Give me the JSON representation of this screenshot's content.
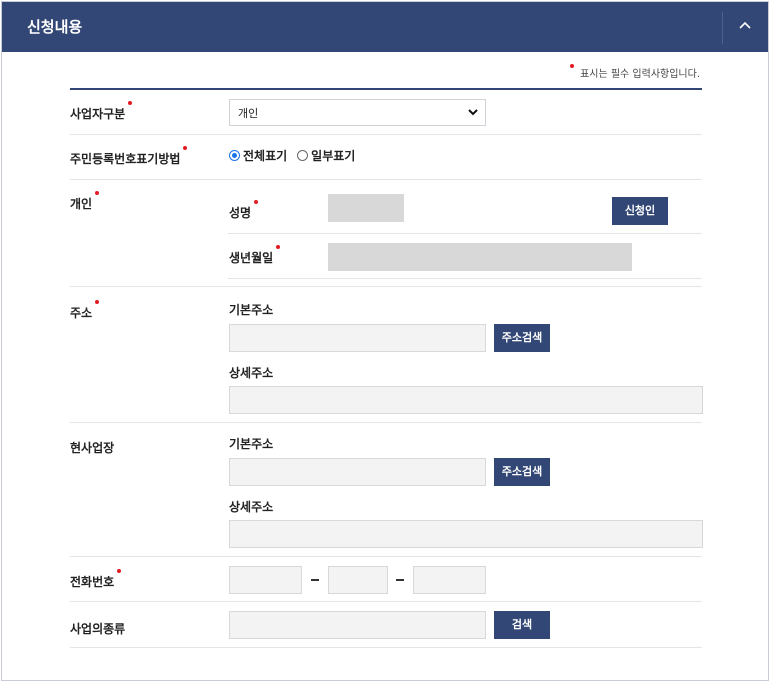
{
  "header": {
    "title": "신청내용"
  },
  "notice": "표시는 필수 입력사항입니다.",
  "fields": {
    "business_type": {
      "label": "사업자구분",
      "selected": "개인"
    },
    "rrn_display": {
      "label": "주민등록번호표기방법",
      "options": [
        "전체표기",
        "일부표기"
      ],
      "selected": "전체표기"
    },
    "individual": {
      "label": "개인",
      "name_label": "성명",
      "apply_button": "신청인",
      "birth_label": "생년월일"
    },
    "address": {
      "label": "주소",
      "basic_label": "기본주소",
      "search_button": "주소검색",
      "detail_label": "상세주소"
    },
    "site": {
      "label": "현사업장",
      "basic_label": "기본주소",
      "search_button": "주소검색",
      "detail_label": "상세주소"
    },
    "phone": {
      "label": "전화번호"
    },
    "business_kind": {
      "label": "사업의종류",
      "search_button": "검색"
    }
  },
  "colors": {
    "primary": "#324775",
    "required": "#e31b23"
  }
}
